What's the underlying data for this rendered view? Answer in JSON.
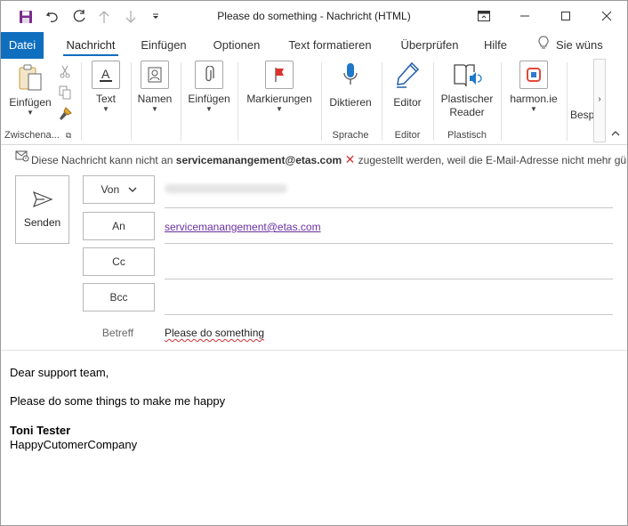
{
  "window": {
    "title_subject": "Please do something",
    "title_sep": " - ",
    "title_type": "Nachricht (HTML)"
  },
  "tabs": [
    "Datei",
    "Nachricht",
    "Einfügen",
    "Optionen",
    "Text formatieren",
    "Überprüfen",
    "Hilfe"
  ],
  "tell_me": "Sie wüns",
  "ribbon": {
    "paste": "Einfügen",
    "clipboard_group": "Zwischena...",
    "text": "Text",
    "names": "Namen",
    "insert": "Einfügen",
    "tags": "Markierungen",
    "dictate": "Diktieren",
    "speech_group": "Sprache",
    "editor": "Editor",
    "editor_group": "Editor",
    "reader_line1": "Plastischer",
    "reader_line2": "Reader",
    "plastic_group": "Plastisch",
    "harmonie": "harmon.ie",
    "cut_off": "Besp"
  },
  "notice": {
    "prefix": "Diese Nachricht kann nicht an",
    "address": "servicemanangement@etas.com",
    "suffix": "zugestellt werden, weil die E-Mail-Adresse nicht mehr gülti..."
  },
  "header": {
    "send_label": "Senden",
    "from_label": "Von",
    "to_label": "An",
    "cc_label": "Cc",
    "bcc_label": "Bcc",
    "subject_label": "Betreff",
    "to_value": "servicemanangement@etas.com",
    "subject_value": "Please do something"
  },
  "body": {
    "greeting": "Dear support team,",
    "line1": "Please do some things to make me happy",
    "sig_name": "Toni Tester",
    "sig_company": "HappyCutomerCompany"
  },
  "colors": {
    "accent": "#106ebe",
    "link": "#6b2fa2"
  }
}
